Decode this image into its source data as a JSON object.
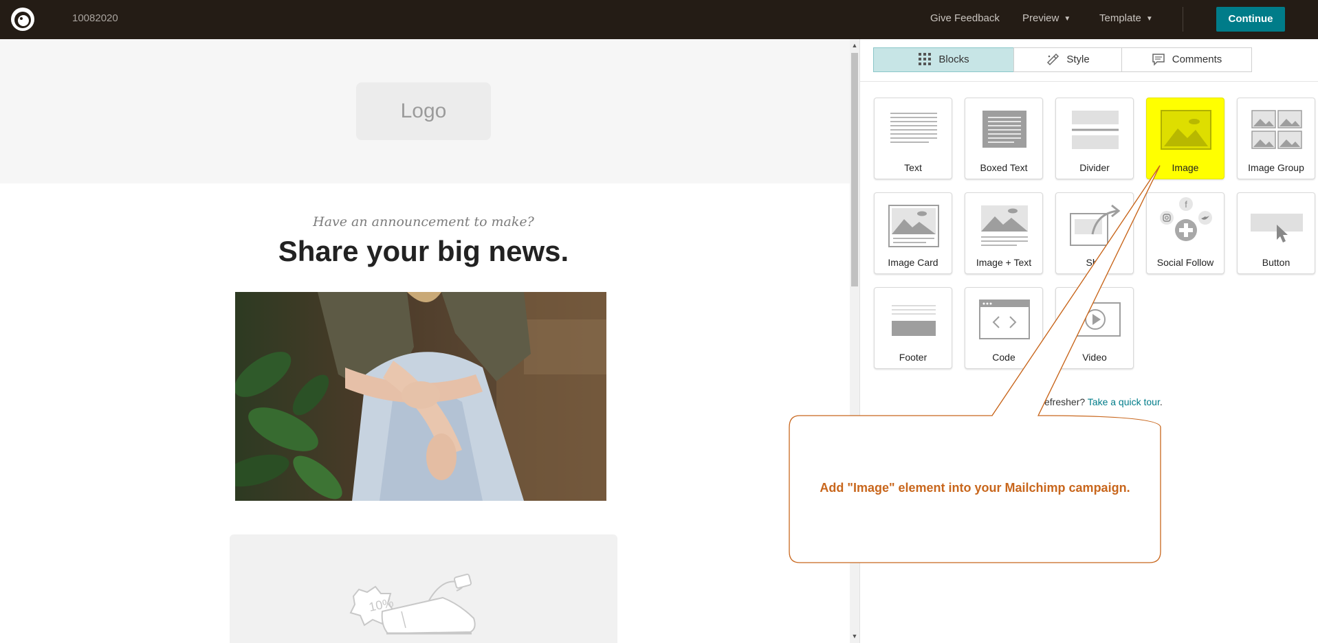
{
  "topbar": {
    "campaign_name": "10082020",
    "give_feedback": "Give Feedback",
    "preview": "Preview",
    "template": "Template",
    "continue": "Continue"
  },
  "email": {
    "logo_placeholder": "Logo",
    "subheading": "Have an announcement to make?",
    "headline": "Share your big news."
  },
  "panel": {
    "tabs": [
      {
        "label": "Blocks",
        "active": true
      },
      {
        "label": "Style",
        "active": false
      },
      {
        "label": "Comments",
        "active": false
      }
    ],
    "blocks": [
      {
        "label": "Text",
        "icon": "text-block-icon"
      },
      {
        "label": "Boxed Text",
        "icon": "boxed-text-block-icon"
      },
      {
        "label": "Divider",
        "icon": "divider-block-icon"
      },
      {
        "label": "Image",
        "icon": "image-block-icon",
        "highlighted": true
      },
      {
        "label": "Image Group",
        "icon": "image-group-block-icon"
      },
      {
        "label": "Image Card",
        "icon": "image-card-block-icon"
      },
      {
        "label": "Image + Text",
        "icon": "image-text-block-icon"
      },
      {
        "label": "Sha",
        "icon": "share-block-icon"
      },
      {
        "label": "Social Follow",
        "icon": "social-follow-block-icon"
      },
      {
        "label": "Button",
        "icon": "button-block-icon"
      },
      {
        "label": "Footer",
        "icon": "footer-block-icon"
      },
      {
        "label": "Code",
        "icon": "code-block-icon"
      },
      {
        "label": "Video",
        "icon": "video-block-icon"
      }
    ],
    "tour_prefix": "efresher? ",
    "tour_link": "Take a quick tour",
    "tour_suffix": "."
  },
  "callout": {
    "text": "Add \"Image\" element into your Mailchimp campaign."
  },
  "colors": {
    "topbar": "#241c15",
    "continue_button": "#007c89",
    "active_tab": "#c7e5e6",
    "highlight": "#ffff00",
    "callout": "#c8661c",
    "link": "#007c89"
  }
}
